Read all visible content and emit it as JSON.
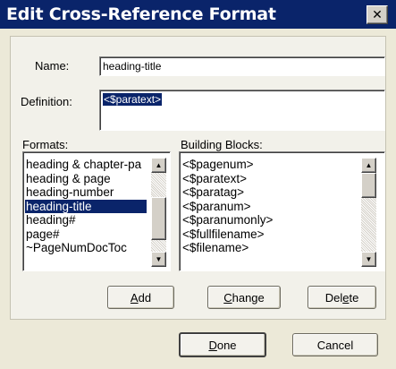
{
  "window": {
    "title": "Edit Cross-Reference Format",
    "close_glyph": "✕"
  },
  "fields": {
    "name_label": "Name:",
    "name_value": "heading-title",
    "definition_label": "Definition:",
    "definition_value": "<$paratext>"
  },
  "formats": {
    "label": "Formats:",
    "items": [
      "heading & chapter-pa",
      "heading & page",
      "heading-number",
      "heading-title",
      "heading#",
      "page#",
      "~PageNumDocToc"
    ],
    "selected_index": 3
  },
  "building_blocks": {
    "label": "Building Blocks:",
    "items": [
      "<$pagenum>",
      "<$paratext>",
      "<$paratag>",
      "<$paranum>",
      "<$paranumonly>",
      "<$fullfilename>",
      "<$filename>"
    ]
  },
  "buttons": {
    "add": {
      "mnemonic": "A",
      "rest": "dd"
    },
    "change": {
      "mnemonic": "C",
      "rest": "hange"
    },
    "delete_pre": "Del",
    "delete_mnemonic": "e",
    "delete_post": "te",
    "done": {
      "mnemonic": "D",
      "rest": "one"
    },
    "cancel": "Cancel"
  },
  "icons": {
    "scroll_up": "▲",
    "scroll_down": "▼"
  }
}
